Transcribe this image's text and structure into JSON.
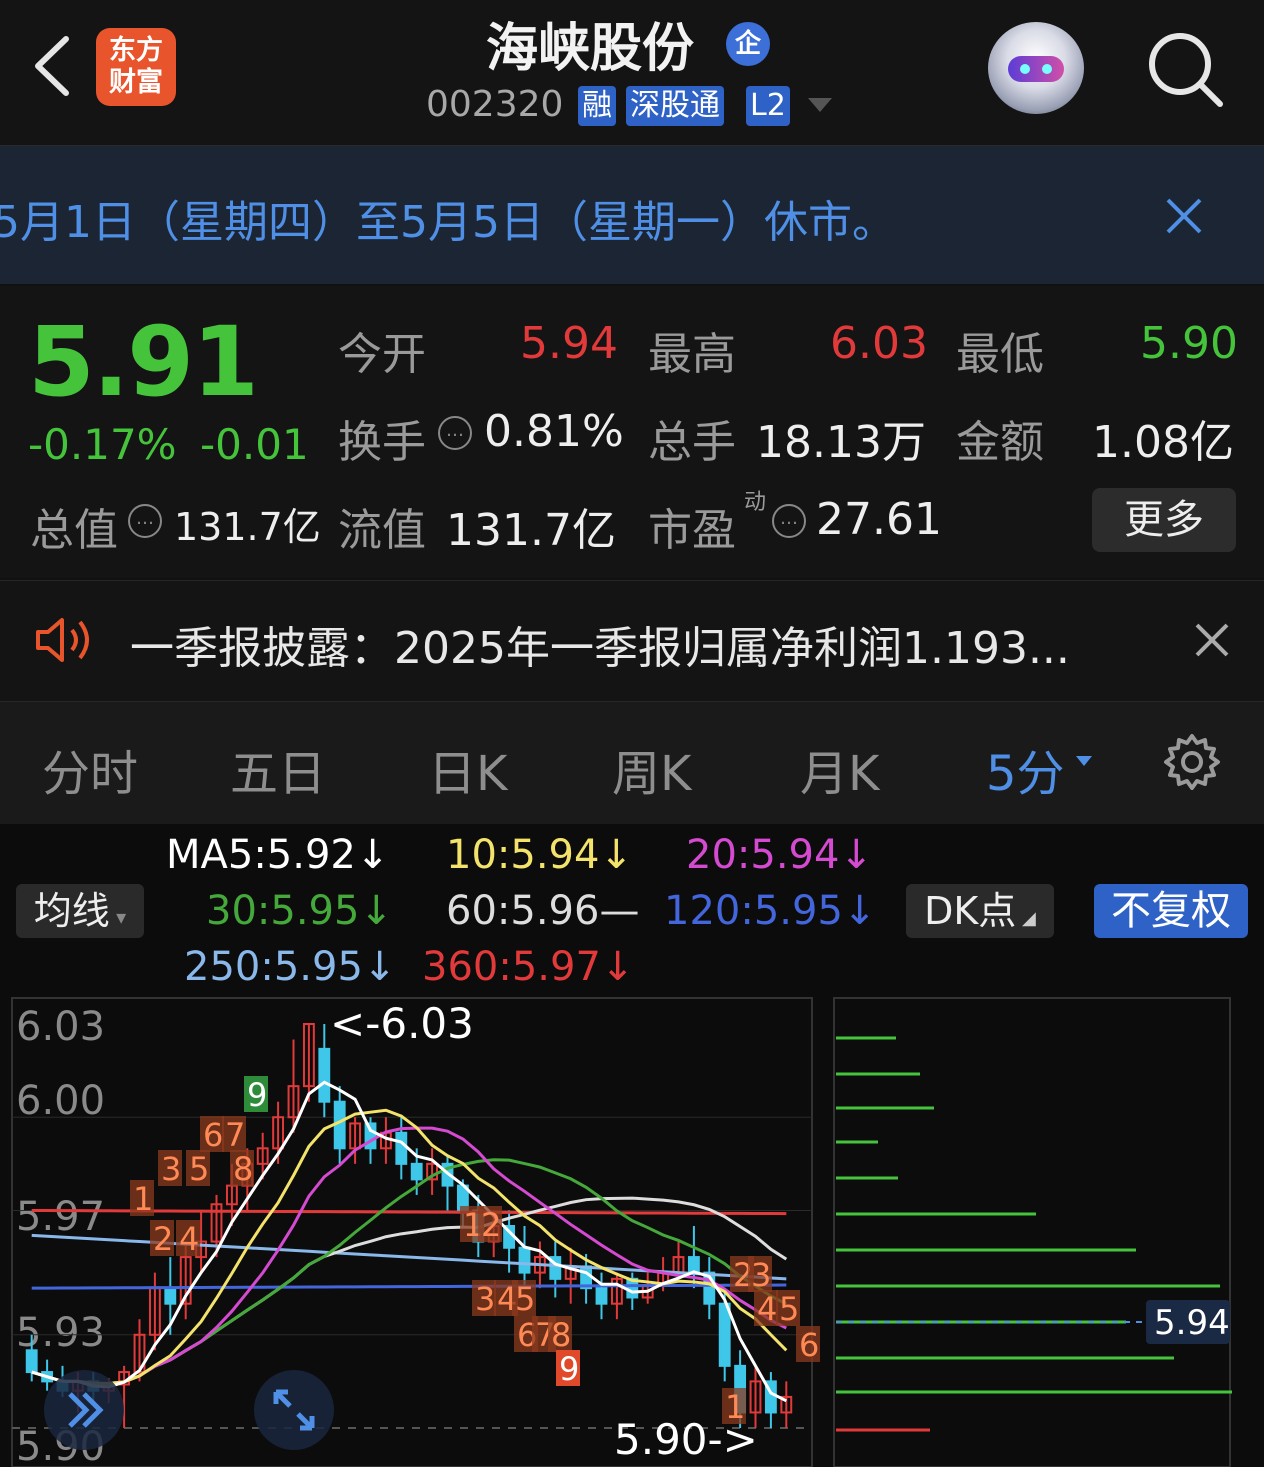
{
  "header": {
    "logo_line1": "东方",
    "logo_line2": "财富",
    "stock_name": "海峡股份",
    "qi_badge": "企",
    "code": "002320",
    "tags": [
      "融",
      "深股通",
      "L2"
    ]
  },
  "notice": {
    "text": "5月1日（星期四）至5月5日（星期一）休市。"
  },
  "quote": {
    "price": "5.91",
    "change_pct": "-0.17%",
    "change": "-0.01",
    "fields": {
      "open_label": "今开",
      "open": "5.94",
      "high_label": "最高",
      "high": "6.03",
      "low_label": "最低",
      "low": "5.90",
      "turnover_label": "换手",
      "turnover": "0.81%",
      "volume_label": "总手",
      "volume": "18.13万",
      "amount_label": "金额",
      "amount": "1.08亿",
      "total_value_label": "总值",
      "total_value": "131.7亿",
      "float_value_label": "流值",
      "float_value": "131.7亿",
      "pe_label": "市盈",
      "pe_sup": "动",
      "pe": "27.61"
    },
    "more_label": "更多"
  },
  "announcement": {
    "text": "一季报披露：2025年一季报归属净利润1.193..."
  },
  "tabs": {
    "items": [
      "分时",
      "五日",
      "日K",
      "周K",
      "月K",
      "5分"
    ],
    "active_index": 5
  },
  "chart_controls": {
    "ma_button": "均线",
    "dk_button": "DK点",
    "fq_button": "不复权"
  },
  "ma_legend": {
    "ma5": "MA5:5.92↓",
    "ma10": "10:5.94↓",
    "ma20": "20:5.94↓",
    "ma30": "30:5.95↓",
    "ma60": "60:5.96—",
    "ma120": "120:5.95↓",
    "ma250": "250:5.95↓",
    "ma360": "360:5.97↓"
  },
  "colors": {
    "up": "#e23a3a",
    "down": "#45c43b",
    "accent": "#4f8fe6",
    "ma5": "#ffffff",
    "ma10": "#f3e36b",
    "ma20": "#d44ad0",
    "ma30": "#45a83a",
    "ma60": "#dddddd",
    "ma120": "#4466dd",
    "ma250": "#8ab8ea",
    "ma360": "#e23a3a"
  },
  "chart_data": {
    "type": "candlestick",
    "period": "5分",
    "y_ticks": [
      "6.03",
      "6.00",
      "5.97",
      "5.93",
      "5.90"
    ],
    "ylim": [
      5.9,
      6.03
    ],
    "max_marker": "<-6.03",
    "min_marker": "5.90->",
    "order_book_price": "5.94",
    "dk_counts": [
      "1",
      "2",
      "4",
      "3",
      "5",
      "8",
      "6",
      "7",
      "9",
      "1",
      "2",
      "3",
      "4",
      "5",
      "6",
      "7",
      "8",
      "9",
      "2",
      "3",
      "4",
      "5",
      "6",
      "1"
    ]
  }
}
